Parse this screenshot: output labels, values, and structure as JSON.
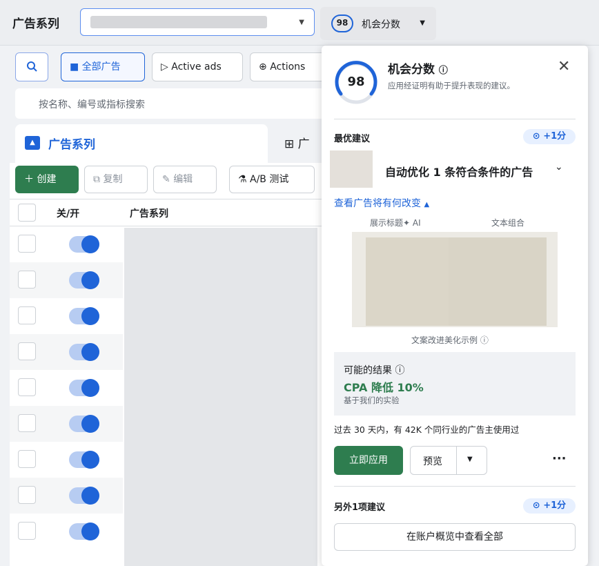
{
  "header": {
    "title": "广告系列",
    "score_value": "98",
    "score_label": "机会分数"
  },
  "toolbar": {
    "all_ads": "全部广告",
    "active_ads": "Active ads",
    "actions": "Actions",
    "search_placeholder": "按名称、编号或指标搜索"
  },
  "tabs": {
    "campaigns": "广告系列",
    "adsets_partial": "广"
  },
  "action_row": {
    "create": "创建",
    "copy": "复制",
    "edit": "编辑",
    "ab_test": "A/B 测试"
  },
  "table": {
    "columns": [
      "关/开",
      "广告系列"
    ],
    "toggles_on": [
      true,
      true,
      true,
      true,
      true,
      true,
      true,
      true,
      true
    ]
  },
  "panel": {
    "score_value": "98",
    "title": "机会分数",
    "subtitle": "应用经证明有助于提升表现的建议。",
    "best_label": "最优建议",
    "best_points": "+1分",
    "best_title": "自动优化 1 条符合条件的广告",
    "see_change": "查看广告将有何改变",
    "col_headline": "展示标题",
    "col_headline_ai": "AI",
    "col_text": "文本组合",
    "preview_caption": "文案改进美化示例",
    "result_label": "可能的结果",
    "result_value": "CPA 降低 10%",
    "result_note": "基于我们的实验",
    "usage_text": "过去 30 天内，有 42K 个同行业的广告主使用过",
    "apply": "立即应用",
    "preview": "预览",
    "more": "···",
    "other_label": "另外1项建议",
    "other_points": "+1分",
    "view_all": "在账户概览中查看全部"
  },
  "colors": {
    "brand_blue": "#1f64d8",
    "success_green": "#2e7d4f"
  }
}
